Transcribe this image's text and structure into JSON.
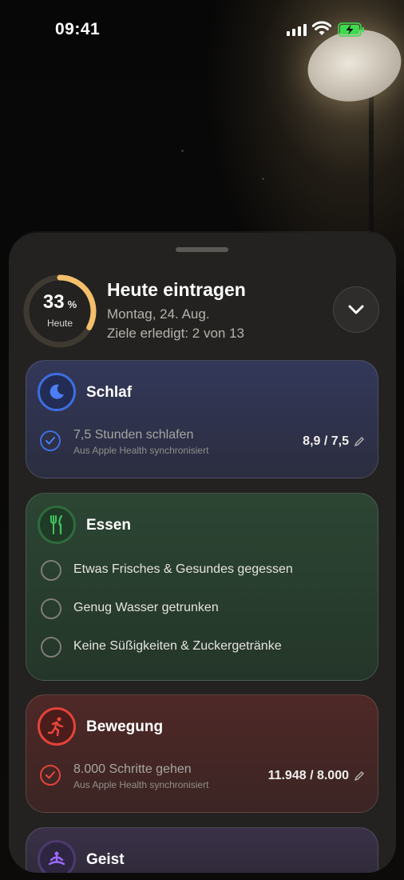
{
  "status_bar": {
    "time": "09:41"
  },
  "sheet": {
    "progress": {
      "value": "33",
      "unit": "%",
      "label": "Heute",
      "fraction": 0.33
    },
    "title": "Heute eintragen",
    "date": "Montag, 24. Aug.",
    "goals_summary": "Ziele erledigt: 2 von 13"
  },
  "categories": {
    "sleep": {
      "title": "Schlaf",
      "color": "#3d6ee0",
      "item": {
        "title": "7,5 Stunden schlafen",
        "subtitle": "Aus Apple Health synchronisiert",
        "value": "8,9 / 7,5"
      }
    },
    "food": {
      "title": "Essen",
      "color": "#3fb95a",
      "items": [
        {
          "title": "Etwas Frisches & Gesundes gegessen"
        },
        {
          "title": "Genug Wasser getrunken"
        },
        {
          "title": "Keine Süßigkeiten & Zuckergetränke"
        }
      ]
    },
    "move": {
      "title": "Bewegung",
      "color": "#e5423a",
      "item": {
        "title": "8.000 Schritte gehen",
        "subtitle": "Aus Apple Health synchronisiert",
        "value": "11.948 / 8.000"
      }
    },
    "mind": {
      "title": "Geist",
      "color": "#8b5cf0"
    }
  }
}
